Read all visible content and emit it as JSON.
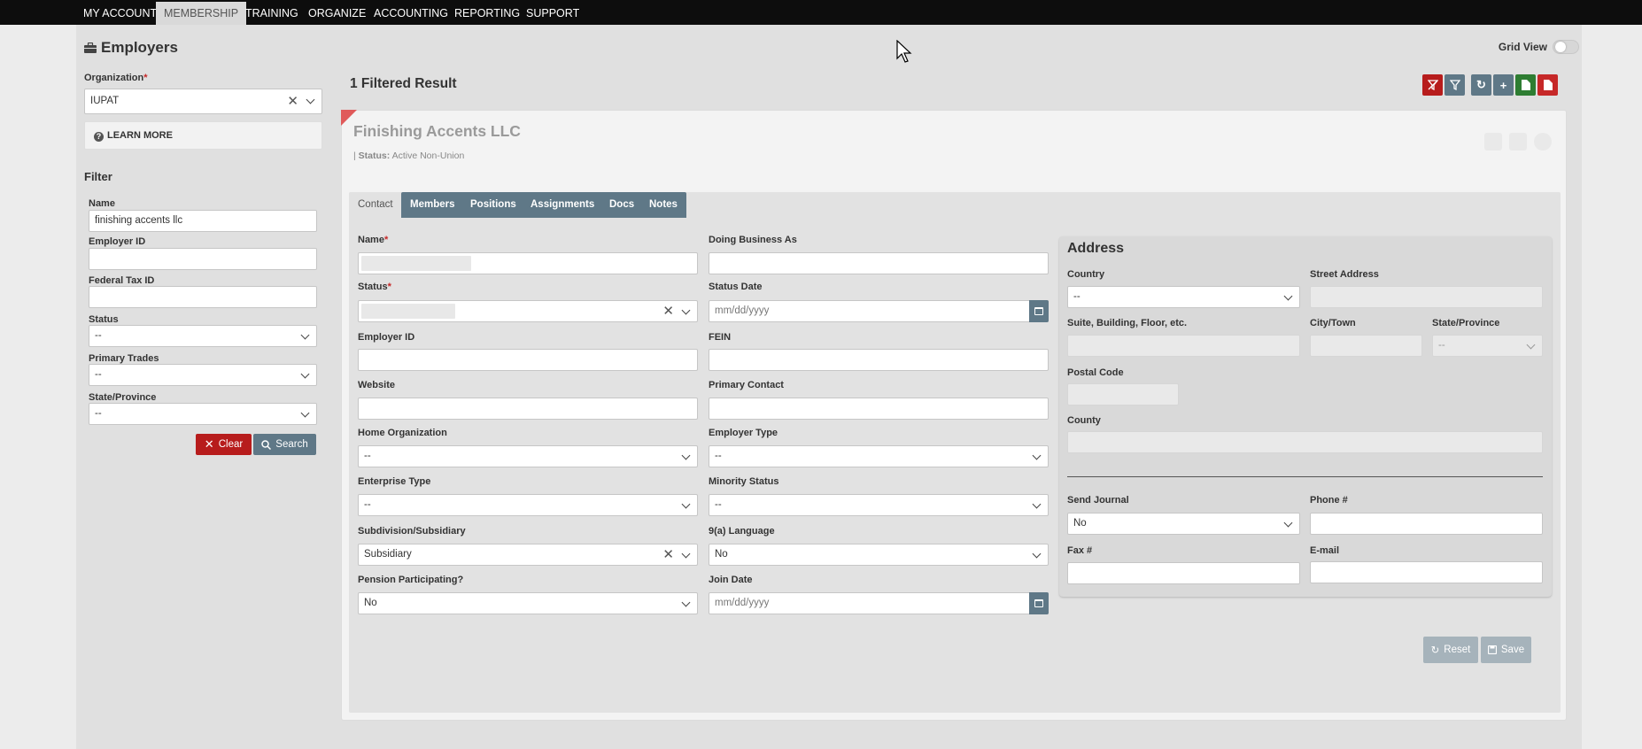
{
  "nav": {
    "items": [
      {
        "label": "MY ACCOUNT"
      },
      {
        "label": "MEMBERSHIP",
        "active": true
      },
      {
        "label": "TRAINING"
      },
      {
        "label": "ORGANIZE"
      },
      {
        "label": "ACCOUNTING"
      },
      {
        "label": "REPORTING"
      },
      {
        "label": "SUPPORT"
      }
    ]
  },
  "page": {
    "title": "Employers",
    "icon": "briefcase-icon",
    "grid_view_label": "Grid View",
    "grid_view_on": false
  },
  "sidebar": {
    "organization_label": "Organization",
    "organization_value": "IUPAT",
    "learn_more": "LEARN MORE",
    "filter_title": "Filter",
    "name_label": "Name",
    "name_value": "finishing accents llc",
    "employer_id_label": "Employer ID",
    "federal_tax_id_label": "Federal Tax ID",
    "status_label": "Status",
    "status_value": "--",
    "primary_trades_label": "Primary Trades",
    "primary_trades_value": "--",
    "state_label": "State/Province",
    "state_value": "--",
    "clear_label": "Clear",
    "search_label": "Search"
  },
  "results": {
    "count_text": "1 Filtered Result",
    "toolbar_icons": [
      "clear-filter-icon",
      "filter-icon",
      "refresh-icon",
      "add-icon",
      "excel-export-icon",
      "pdf-export-icon"
    ]
  },
  "employer": {
    "name": "Finishing Accents LLC",
    "status_prefix": "| ",
    "status_label": "Status:",
    "status_value": "Active Non-Union"
  },
  "tabs": [
    "Contact",
    "Members",
    "Positions",
    "Assignments",
    "Docs",
    "Notes"
  ],
  "contact": {
    "name_label": "Name",
    "dba_label": "Doing Business As",
    "status_label": "Status",
    "status_date_label": "Status Date",
    "date_placeholder": "mm/dd/yyyy",
    "employer_id_label": "Employer ID",
    "fein_label": "FEIN",
    "website_label": "Website",
    "primary_contact_label": "Primary Contact",
    "home_org_label": "Home Organization",
    "home_org_value": "--",
    "employer_type_label": "Employer Type",
    "employer_type_value": "--",
    "enterprise_type_label": "Enterprise Type",
    "enterprise_type_value": "--",
    "minority_status_label": "Minority Status",
    "minority_status_value": "--",
    "subdivision_label": "Subdivision/Subsidiary",
    "subdivision_value": "Subsidiary",
    "language_label": "9(a) Language",
    "language_value": "No",
    "pension_label": "Pension Participating?",
    "pension_value": "No",
    "join_date_label": "Join Date"
  },
  "address": {
    "title": "Address",
    "country_label": "Country",
    "country_value": "--",
    "street_label": "Street Address",
    "suite_label": "Suite, Building, Floor, etc.",
    "city_label": "City/Town",
    "state_label": "State/Province",
    "state_value": "--",
    "postal_label": "Postal Code",
    "county_label": "County",
    "send_journal_label": "Send Journal",
    "send_journal_value": "No",
    "phone_label": "Phone #",
    "fax_label": "Fax #",
    "email_label": "E-mail"
  },
  "actions": {
    "reset_label": "Reset",
    "save_label": "Save"
  }
}
